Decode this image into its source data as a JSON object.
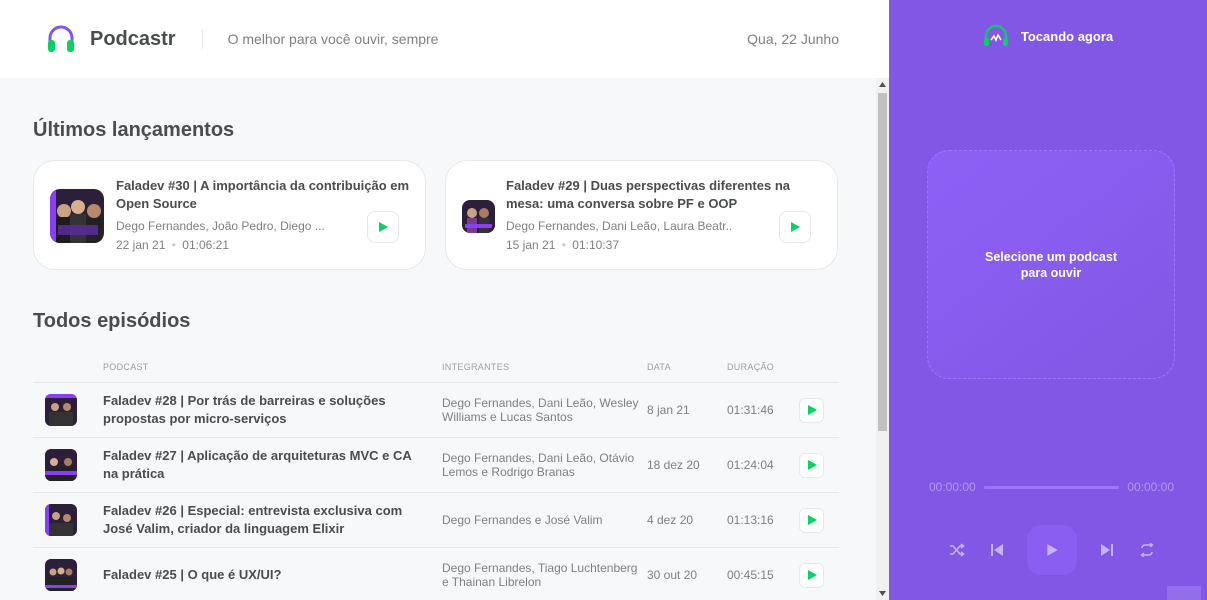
{
  "header": {
    "brand": "Podcastr",
    "tagline": "O melhor para você ouvir, sempre",
    "date": "Qua, 22 Junho",
    "logo_icon": "headphones-icon"
  },
  "latest": {
    "title": "Últimos lançamentos",
    "episodes": [
      {
        "title": "Faladev #30 | A importância da contribuição em Open Source",
        "members": "Dego Fernandes, João Pedro, Diego ...",
        "date": "22 jan 21",
        "duration": "01:06:21"
      },
      {
        "title": "Faladev #29 | Duas perspectivas diferentes na mesa: uma conversa sobre PF e OOP",
        "members": "Dego Fernandes, Dani Leão, Laura Beatr...",
        "date": "15 jan 21",
        "duration": "01:10:37"
      }
    ]
  },
  "all": {
    "title": "Todos episódios",
    "columns": [
      "Podcast",
      "Integrantes",
      "Data",
      "Duração"
    ],
    "rows": [
      {
        "title": "Faladev #28 | Por trás de barreiras e soluções propostas por micro-serviços",
        "members": "Dego Fernandes, Dani Leão, Wesley Williams e Lucas Santos",
        "date": "8 jan 21",
        "duration": "01:31:46"
      },
      {
        "title": "Faladev #27 | Aplicação de arquiteturas MVC e CA na prática",
        "members": "Dego Fernandes, Dani Leão, Otávio Lemos e Rodrigo Branas",
        "date": "18 dez 20",
        "duration": "01:24:04"
      },
      {
        "title": "Faladev #26 | Especial: entrevista exclusiva com José Valim, criador da linguagem Elixir",
        "members": "Dego Fernandes e José Valim",
        "date": "4 dez 20",
        "duration": "01:13:16"
      },
      {
        "title": "Faladev #25 | O que é UX/UI?",
        "members": "Dego Fernandes, Tiago Luchtenberg e Thainan Librelon",
        "date": "30 out 20",
        "duration": "00:45:15"
      }
    ]
  },
  "player": {
    "title": "Tocando agora",
    "empty_message": "Selecione um podcast para ouvir",
    "current_time": "00:00:00",
    "total_time": "00:00:00",
    "progress": 0
  },
  "colors": {
    "accent": "#8257e5",
    "play_green": "#04d361",
    "text": "#494d4b",
    "muted": "#808080"
  }
}
